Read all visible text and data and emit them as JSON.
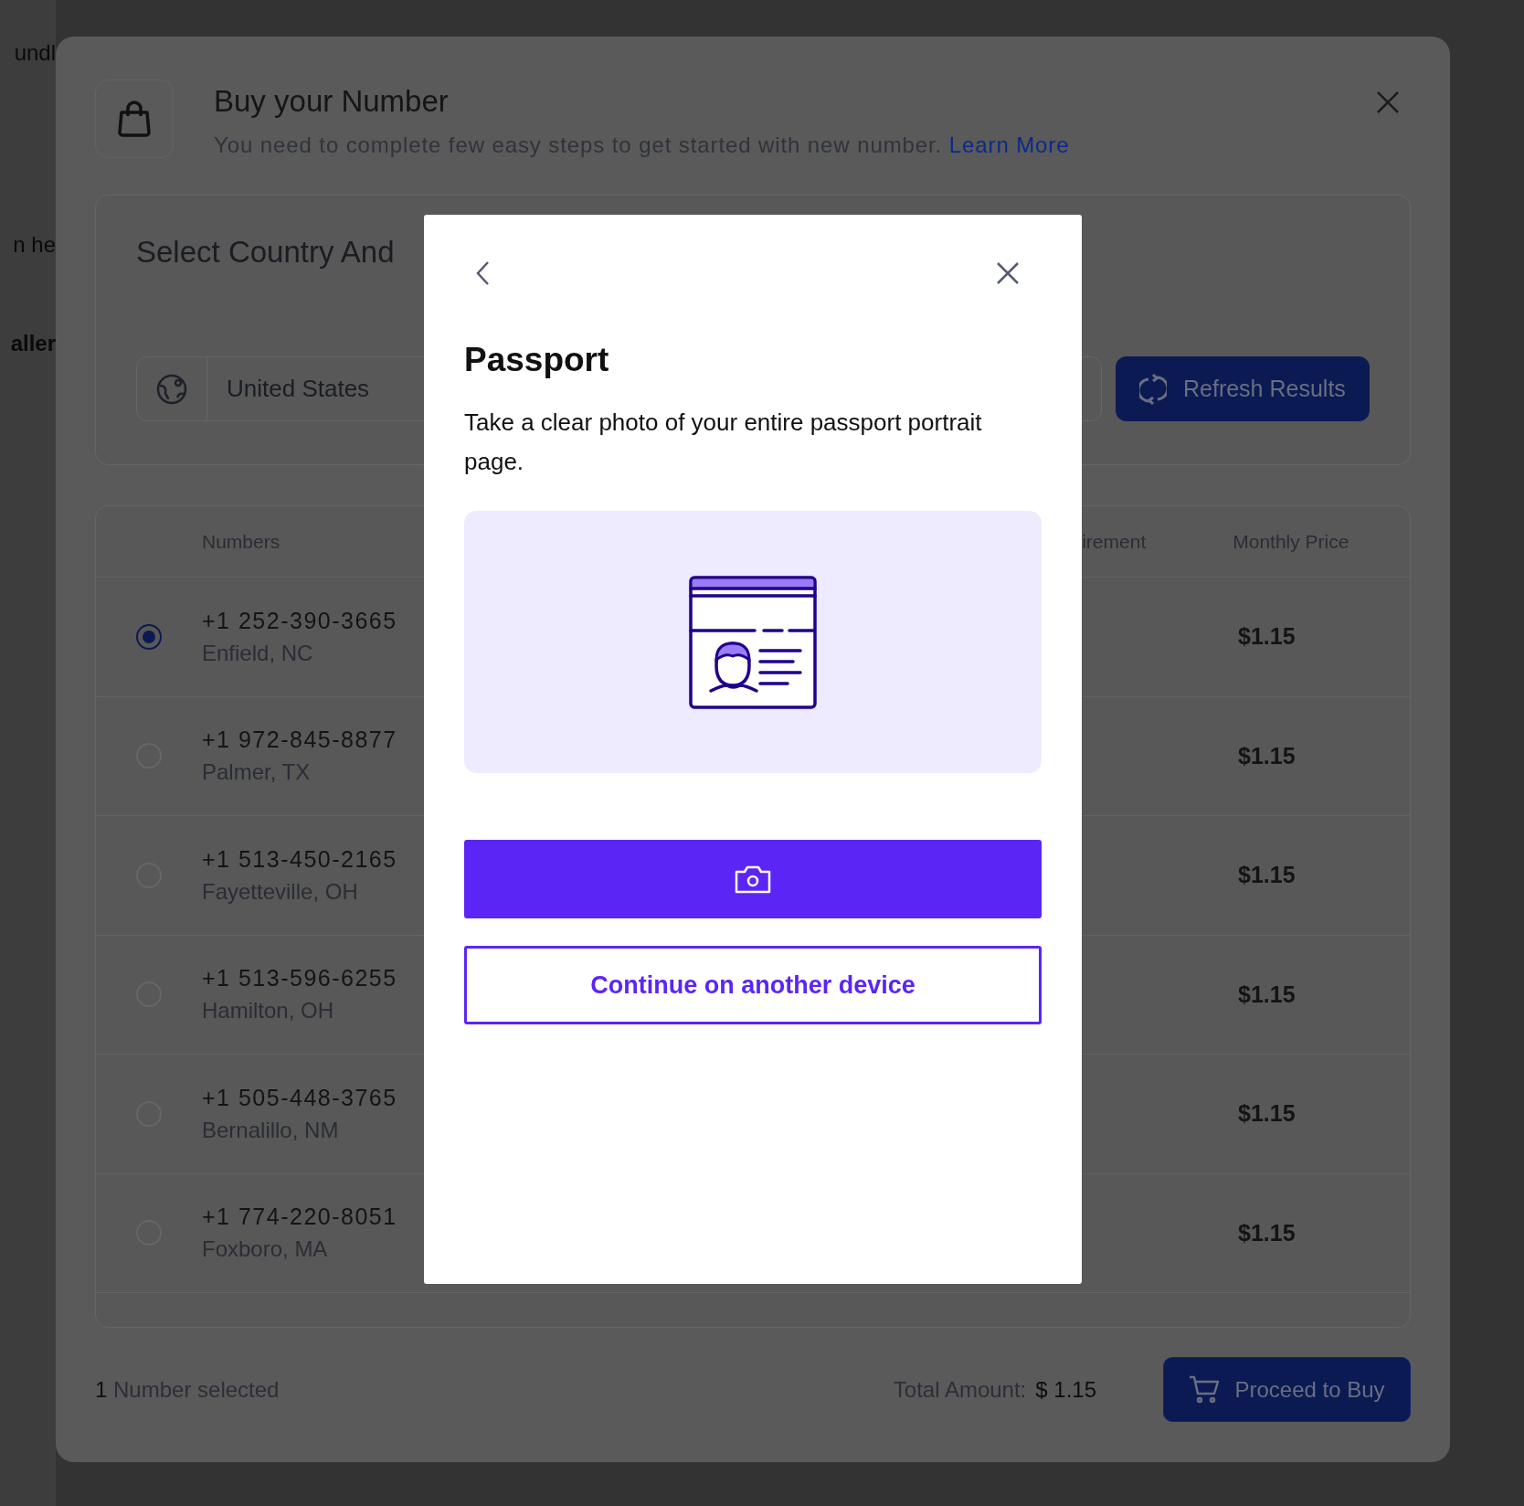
{
  "background_app": {
    "texts": [
      "undl",
      "n he",
      "aller"
    ]
  },
  "buy_dialog": {
    "title": "Buy your Number",
    "subtitle": "You need to complete few easy steps to get started with new number.",
    "learn_more": "Learn More",
    "country_section": {
      "title": "Select Country And",
      "country": "United States",
      "refresh_button": "Refresh Results"
    },
    "table": {
      "columns": [
        "Numbers",
        "irement",
        "Monthly Price"
      ],
      "rows": [
        {
          "number": "+1 252-390-3665",
          "location": "Enfield, NC",
          "price": "$1.15",
          "selected": true
        },
        {
          "number": "+1 972-845-8877",
          "location": "Palmer, TX",
          "price": "$1.15",
          "selected": false
        },
        {
          "number": "+1 513-450-2165",
          "location": "Fayetteville, OH",
          "price": "$1.15",
          "selected": false
        },
        {
          "number": "+1 513-596-6255",
          "location": "Hamilton, OH",
          "price": "$1.15",
          "selected": false
        },
        {
          "number": "+1 505-448-3765",
          "location": "Bernalillo, NM",
          "price": "$1.15",
          "selected": false
        },
        {
          "number": "+1 774-220-8051",
          "location": "Foxboro, MA",
          "price": "$1.15",
          "selected": false
        }
      ]
    },
    "footer": {
      "count": "1",
      "selected_label": "Number selected",
      "total_label": "Total Amount:",
      "total_value": "$ 1.15",
      "proceed_button": "Proceed to Buy"
    }
  },
  "passport_dialog": {
    "title": "Passport",
    "instructions": "Take a clear photo of your entire passport portrait page.",
    "secondary_button": "Continue on another device"
  }
}
